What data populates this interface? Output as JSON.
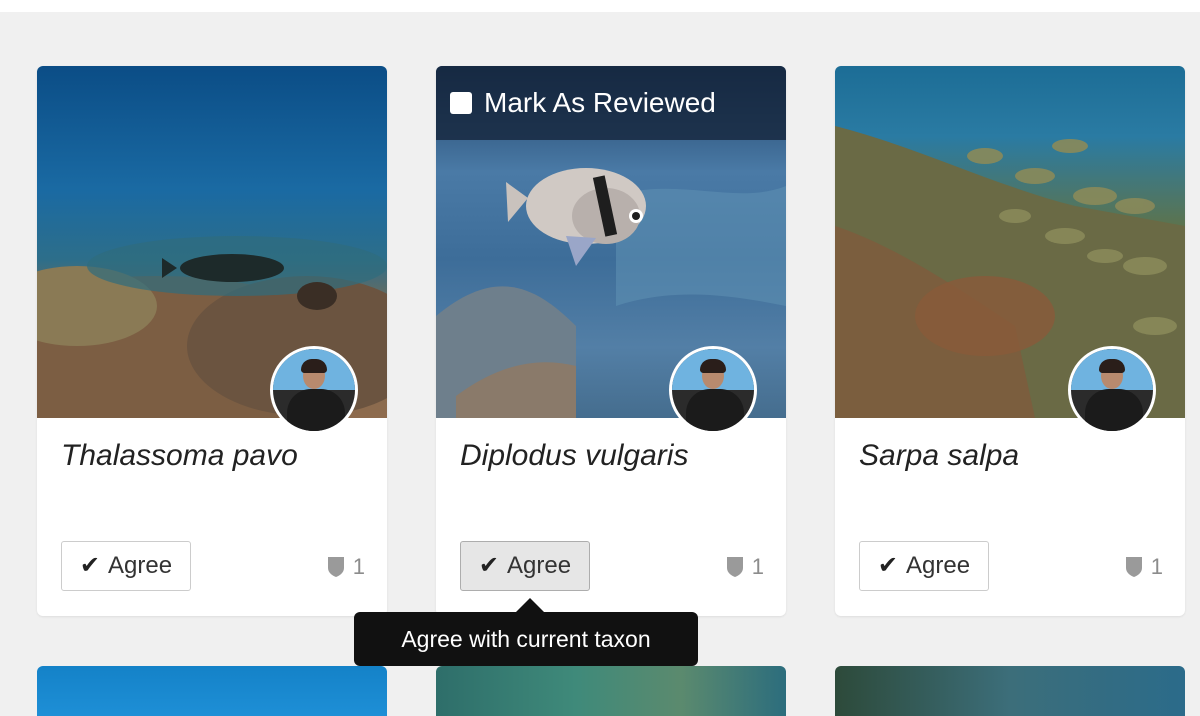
{
  "cards": [
    {
      "taxon": "Thalassoma pavo",
      "agree_label": "Agree",
      "identification_count": "1"
    },
    {
      "taxon": "Diplodus vulgaris",
      "agree_label": "Agree",
      "identification_count": "1",
      "review_label": "Mark As Reviewed"
    },
    {
      "taxon": "Sarpa salpa",
      "agree_label": "Agree",
      "identification_count": "1"
    }
  ],
  "tooltip": {
    "text": "Agree with current taxon"
  },
  "colors": {
    "background": "#f0f0f0",
    "card": "#ffffff",
    "tooltip": "#111111",
    "shield": "#9a9a9a"
  },
  "icons": {
    "agree": "check-icon",
    "identifications": "shield-icon"
  }
}
